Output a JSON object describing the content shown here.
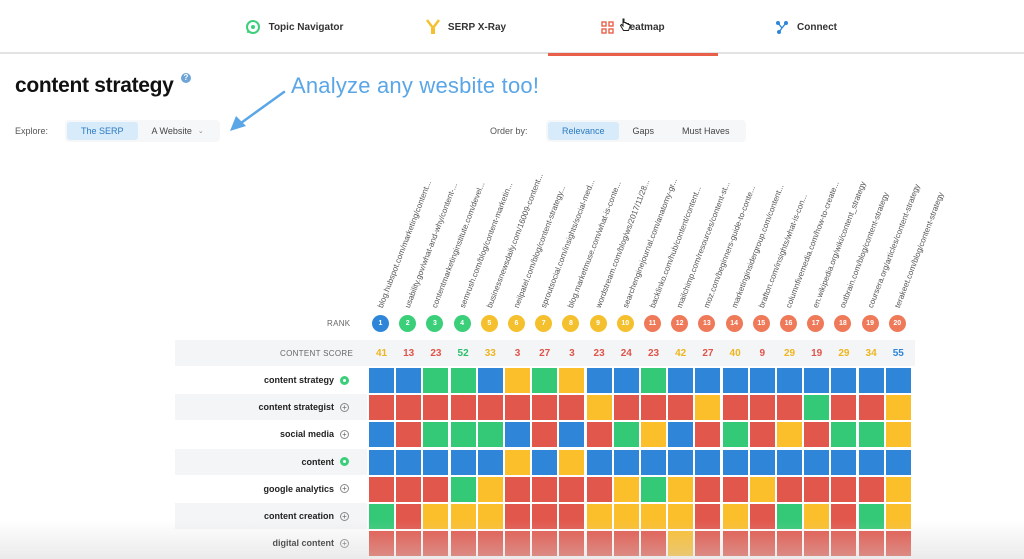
{
  "nav": {
    "tabs": [
      {
        "label": "Topic Navigator",
        "icon": "compass-icon"
      },
      {
        "label": "SERP X-Ray",
        "icon": "xray-icon"
      },
      {
        "label": "Heatmap",
        "icon": "grid-icon",
        "active": true
      },
      {
        "label": "Connect",
        "icon": "network-icon"
      }
    ]
  },
  "page": {
    "title": "content strategy",
    "help": "?",
    "annotation": "Analyze any wesbite too!"
  },
  "explore": {
    "label": "Explore:",
    "options": [
      "The SERP",
      "A Website"
    ],
    "selected": "The SERP",
    "chevron": "⌄"
  },
  "order": {
    "label": "Order by:",
    "options": [
      "Relevance",
      "Gaps",
      "Must Haves"
    ],
    "selected": "Relevance"
  },
  "urls": [
    "blog.hubspot.com/marketing/content...",
    "usability.gov/what-and-why/content-...",
    "contentmarketinginstitute.com/devel...",
    "semrush.com/blog/content-marketin...",
    "businessnewsdaily.com/16009-content...",
    "neilpatel.com/blog/content-strategy...",
    "sproutsocial.com/insights/social-med...",
    "blog.marketmuse.com/what-is-conte...",
    "wordstream.com/blog/ws/2017/11/28...",
    "searchenginejournal.com/anatomy-gr...",
    "backlinko.com/hub/content/content...",
    "mailchimp.com/resources/content-st...",
    "moz.com/beginners-guide-to-conte...",
    "marketinginsidergroup.com/content...",
    "brafton.com/insights/what-is-con...",
    "columnfivemedia.com/how-to-create...",
    "en.wikipedia.org/wiki/content_strategy",
    "outbrain.com/blog/content-strategy",
    "coursera.org/articles/content-strategy",
    "terakeet.com/blog/content-strategy"
  ],
  "rank_label": "RANK",
  "ranks": [
    {
      "n": "1",
      "color": "#2f86d9"
    },
    {
      "n": "2",
      "color": "#3ccf7a"
    },
    {
      "n": "3",
      "color": "#3ccf7a"
    },
    {
      "n": "4",
      "color": "#3ccf7a"
    },
    {
      "n": "5",
      "color": "#f5c02d"
    },
    {
      "n": "6",
      "color": "#f5c02d"
    },
    {
      "n": "7",
      "color": "#f5c02d"
    },
    {
      "n": "8",
      "color": "#f5c02d"
    },
    {
      "n": "9",
      "color": "#f5c02d"
    },
    {
      "n": "10",
      "color": "#f5c02d"
    },
    {
      "n": "11",
      "color": "#ef7a5a"
    },
    {
      "n": "12",
      "color": "#ef7a5a"
    },
    {
      "n": "13",
      "color": "#ef7a5a"
    },
    {
      "n": "14",
      "color": "#ef7a5a"
    },
    {
      "n": "15",
      "color": "#ef7a5a"
    },
    {
      "n": "16",
      "color": "#ef7a5a"
    },
    {
      "n": "17",
      "color": "#ef7a5a"
    },
    {
      "n": "18",
      "color": "#ef7a5a"
    },
    {
      "n": "19",
      "color": "#ef7a5a"
    },
    {
      "n": "20",
      "color": "#ef7a5a"
    }
  ],
  "score_label": "CONTENT SCORE",
  "scores": [
    {
      "v": "41",
      "color": "#eeb51c"
    },
    {
      "v": "13",
      "color": "#e0544a"
    },
    {
      "v": "23",
      "color": "#e0544a"
    },
    {
      "v": "52",
      "color": "#2bbf6b"
    },
    {
      "v": "33",
      "color": "#eeb51c"
    },
    {
      "v": "3",
      "color": "#e0544a"
    },
    {
      "v": "27",
      "color": "#e0544a"
    },
    {
      "v": "3",
      "color": "#e0544a"
    },
    {
      "v": "23",
      "color": "#e0544a"
    },
    {
      "v": "24",
      "color": "#e0544a"
    },
    {
      "v": "23",
      "color": "#e0544a"
    },
    {
      "v": "42",
      "color": "#eeb51c"
    },
    {
      "v": "27",
      "color": "#e0544a"
    },
    {
      "v": "40",
      "color": "#eeb51c"
    },
    {
      "v": "9",
      "color": "#e0544a"
    },
    {
      "v": "29",
      "color": "#eeb51c"
    },
    {
      "v": "19",
      "color": "#e0544a"
    },
    {
      "v": "29",
      "color": "#eeb51c"
    },
    {
      "v": "34",
      "color": "#eeb51c"
    },
    {
      "v": "55",
      "color": "#2f86d9"
    }
  ],
  "palette": {
    "B": "#2f86d9",
    "G": "#34c977",
    "Y": "#fbbf2c",
    "R": "#e2574c"
  },
  "keywords": [
    {
      "label": "content strategy",
      "added": true,
      "cells": "BBGGBYGYBBGBBBBBBBBB"
    },
    {
      "label": "content strategist",
      "added": false,
      "cells": "RRRRRRRRYRRRYRRRGRRY"
    },
    {
      "label": "social media",
      "added": false,
      "cells": "BRGGGBRBRGYBRGRYRGGY"
    },
    {
      "label": "content",
      "added": true,
      "cells": "BBBBBYBYBBBBBBBBBBBB"
    },
    {
      "label": "google analytics",
      "added": false,
      "cells": "RRRGYRRRRYGYRRYRRRRY"
    },
    {
      "label": "content creation",
      "added": false,
      "cells": "GRYYYRRRYYYYRYRGYRGY"
    },
    {
      "label": "digital content",
      "added": false,
      "cells": "RRRRRRRRRRRYRRRRRRRR"
    }
  ]
}
